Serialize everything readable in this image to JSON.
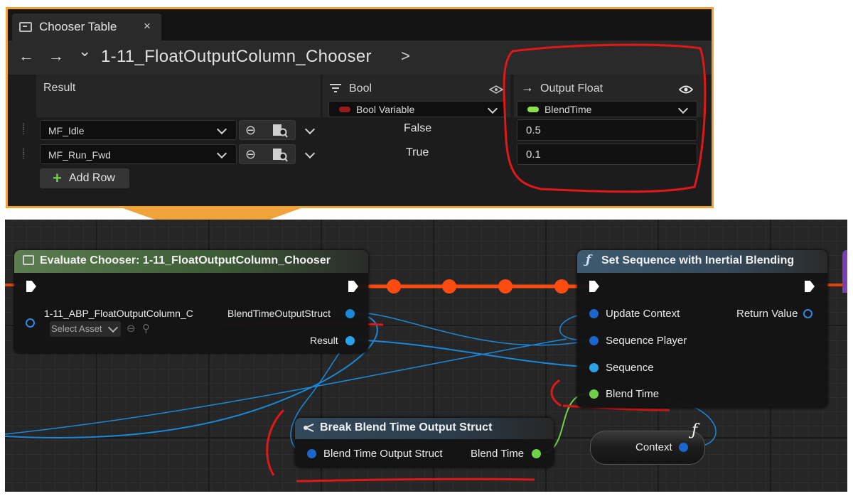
{
  "chooser_window": {
    "tab_title": "Chooser Table",
    "tab_close": "×",
    "breadcrumb_back": "←",
    "breadcrumb_forward": "→",
    "breadcrumb_history": "⌄",
    "asset_path": "1-11_FloatOutputColumn_Chooser",
    "breadcrumb_next": ">",
    "columns": {
      "result_header": "Result",
      "bool_header": "Bool",
      "bool_variable": "Bool Variable",
      "output_header": "Output Float",
      "output_variable": "BlendTime"
    },
    "rows": [
      {
        "result": "MF_Idle",
        "bool": "False",
        "output": "0.5"
      },
      {
        "result": "MF_Run_Fwd",
        "bool": "True",
        "output": "0.1"
      }
    ],
    "add_row_label": "Add Row",
    "colors": {
      "bool_var": "#9c1a1a",
      "float_var": "#8de04a",
      "accent_border": "#f0a23b",
      "annotation": "#e01818"
    }
  },
  "graph": {
    "evaluate_node": {
      "title": "Evaluate Chooser: 1-11_FloatOutputColumn_Chooser",
      "context_label": "1-11_ABP_FloatOutputColumn_C",
      "select_asset": "Select Asset",
      "output_struct_label": "BlendTimeOutputStruct",
      "result_label": "Result"
    },
    "set_sequence_node": {
      "title": "Set Sequence with Inertial Blending",
      "inputs": [
        "Update Context",
        "Sequence Player",
        "Sequence",
        "Blend Time"
      ],
      "return_label": "Return Value"
    },
    "break_node": {
      "title": "Break Blend Time Output Struct",
      "input_label": "Blend Time Output Struct",
      "output_label": "Blend Time"
    },
    "context_node": {
      "label": "Context"
    }
  }
}
